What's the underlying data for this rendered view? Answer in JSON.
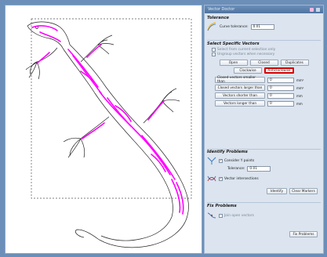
{
  "panel": {
    "title": "Vector Doctor",
    "pin_icon": "pin-icon",
    "close_icon": "close-icon",
    "tolerance": {
      "heading": "Tolerance",
      "curve_label": "Curve tolerance:",
      "curve_value": "0.01"
    },
    "select_specific": {
      "heading": "Select Specific Vectors",
      "opt_select_from_current": "Select from current selection only",
      "opt_ungroup": "Ungroup vectors when necessary",
      "buttons_row1": [
        "Open",
        "Closed",
        "Duplicates"
      ],
      "buttons_row2": [
        "Clockwise",
        "Anticlockwise"
      ],
      "filters": [
        {
          "label": "Closed vectors smaller than",
          "value": "0",
          "unit": "mm²"
        },
        {
          "label": "Closed vectors larger than",
          "value": "0",
          "unit": "mm²"
        },
        {
          "label": "Vectors shorter than",
          "value": "0",
          "unit": "mm"
        },
        {
          "label": "Vectors longer than",
          "value": "0",
          "unit": "mm"
        }
      ]
    },
    "identify": {
      "heading": "Identify Problems",
      "consider_ypoints": "Consider Y points",
      "tolerance_label": "Tolerance:",
      "tolerance_value": "0.01",
      "vector_intersections": "Vector intersections",
      "identify_btn": "Identify",
      "clear_markers_btn": "Clear Markers"
    },
    "fix": {
      "heading": "Fix Problems",
      "option_label": "Join open vectors",
      "fix_btn": "Fix Problems"
    }
  },
  "colors": {
    "accent_selection": "#ff00ff",
    "highlight_border": "#d70000",
    "panel_bg": "#dbe4ef",
    "frame_bg": "#6b8fb8"
  }
}
